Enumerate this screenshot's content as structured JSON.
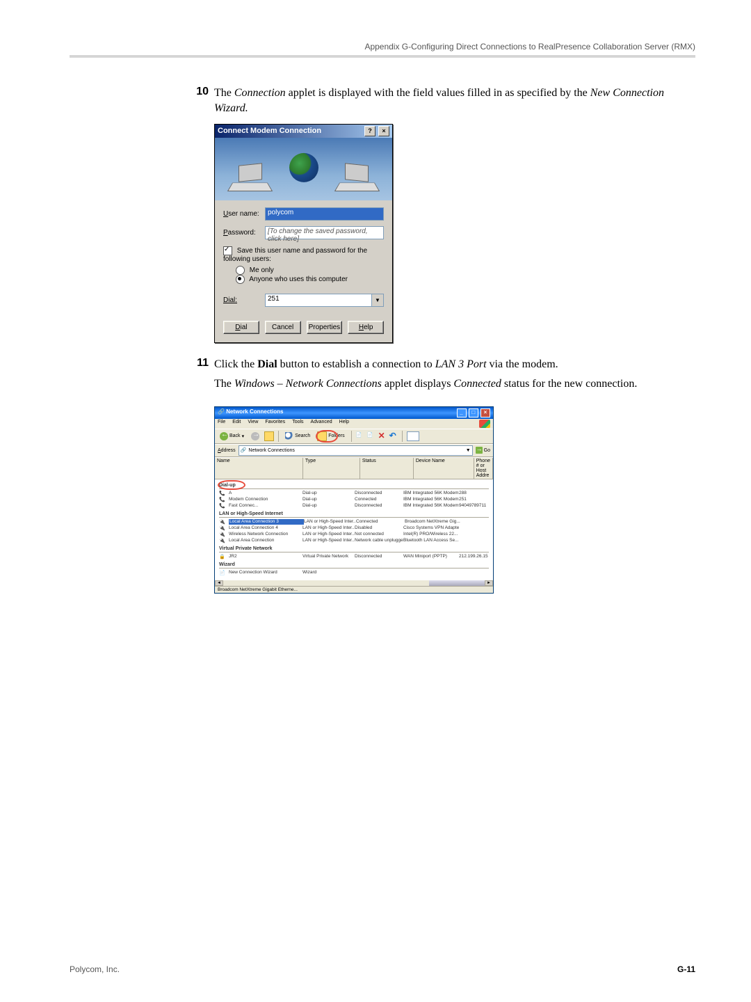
{
  "header": "Appendix G-Configuring Direct Connections to RealPresence Collaboration Server (RMX)",
  "steps": {
    "s10": {
      "num": "10",
      "text_a": "The ",
      "italic_a": "Connection",
      "text_b": " applet is displayed with the field values filled in as specified by the ",
      "italic_b": "New Connection Wizard.",
      "text_c": ""
    },
    "s11": {
      "num": "11",
      "line1_a": "Click the ",
      "line1_bold": "Dial",
      "line1_b": " button to establish a connection to ",
      "line1_italic": "LAN 3 Port",
      "line1_c": " via the modem.",
      "line2_a": "The ",
      "line2_italic_a": "Windows – Network Connections",
      "line2_b": " applet displays ",
      "line2_italic_b": "Connected",
      "line2_c": " status for the new connection."
    }
  },
  "dialog": {
    "title": "Connect Modem Connection",
    "help_btn": "?",
    "close_btn": "×",
    "user_label": "User name:",
    "user_value": "polycom",
    "pass_label": "Password:",
    "pass_placeholder": "[To change the saved password, click here]",
    "save_label": "Save this user name and password for the following users:",
    "me_only": "Me only",
    "anyone": "Anyone who uses this computer",
    "dial_label": "Dial:",
    "dial_value": "251",
    "btn_dial": "Dial",
    "btn_cancel": "Cancel",
    "btn_prop": "Properties",
    "btn_help": "Help"
  },
  "nc": {
    "title": "Network Connections",
    "menu": [
      "File",
      "Edit",
      "View",
      "Favorites",
      "Tools",
      "Advanced",
      "Help"
    ],
    "back": "Back",
    "search": "Search",
    "folders": "Folders",
    "addr_label": "Address",
    "addr_value": "Network Connections",
    "go": "Go",
    "cols": [
      "Name",
      "Type",
      "Status",
      "Device Name",
      "Phone # or Host Addre"
    ],
    "group_dialup": "Dial-up",
    "group_lan": "LAN or High-Speed Internet",
    "group_vpn": "Virtual Private Network",
    "group_wizard": "Wizard",
    "dialup_rows": [
      {
        "name": "A",
        "type": "Dial-up",
        "status": "Disconnected",
        "dev": "IBM Integrated 56K Modem",
        "phone": "288"
      },
      {
        "name": "Modem Connection",
        "type": "Dial-up",
        "status": "Connected",
        "dev": "IBM Integrated 56K Modem",
        "phone": "251"
      },
      {
        "name": "Fast Connec...",
        "type": "Dial-up",
        "status": "Disconnected",
        "dev": "IBM Integrated 56K Modem",
        "phone": "94049789711"
      }
    ],
    "lan_rows": [
      {
        "name": "Local Area Connection 3",
        "type": "LAN or High-Speed Inter...",
        "status": "Connected",
        "dev": "Broadcom NetXtreme Gig...",
        "sel": true
      },
      {
        "name": "Local Area Connection 4",
        "type": "LAN or High-Speed Inter...",
        "status": "Disabled",
        "dev": "Cisco Systems VPN Adapter"
      },
      {
        "name": "Wireless Network Connection",
        "type": "LAN or High-Speed Inter...",
        "status": "Not connected",
        "dev": "Intel(R) PRO/Wireless 22..."
      },
      {
        "name": "Local Area Connection",
        "type": "LAN or High-Speed Inter...",
        "status": "Network cable unplugged",
        "dev": "Bluetooth LAN Access Se..."
      }
    ],
    "vpn_rows": [
      {
        "name": "JR2",
        "type": "Virtual Private Network",
        "status": "Disconnected",
        "dev": "WAN Miniport (PPTP)",
        "phone": "212.199.26.15"
      }
    ],
    "wizard_rows": [
      {
        "name": "New Connection Wizard",
        "type": "Wizard"
      }
    ],
    "status_bar": "Broadcom NetXtreme Gigabit Etherne..."
  },
  "footer": {
    "company": "Polycom, Inc.",
    "page": "G-11"
  }
}
